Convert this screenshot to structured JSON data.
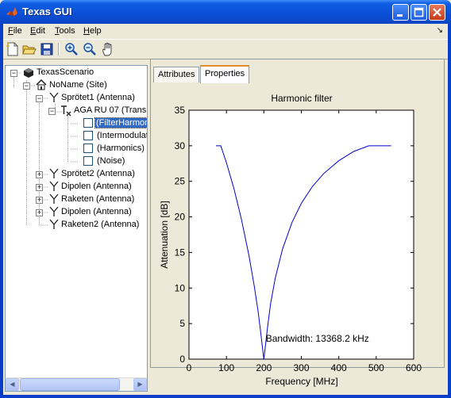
{
  "window": {
    "title": "Texas GUI"
  },
  "menu": [
    {
      "label": "File",
      "u": "F",
      "rest": "ile"
    },
    {
      "label": "Edit",
      "u": "E",
      "rest": "dit"
    },
    {
      "label": "Tools",
      "u": "T",
      "rest": "ools"
    },
    {
      "label": "Help",
      "u": "H",
      "rest": "elp"
    }
  ],
  "toolbar": [
    "new-file-icon",
    "open-folder-icon",
    "save-disk-icon",
    "zoom-in-icon",
    "zoom-out-icon",
    "pan-hand-icon"
  ],
  "tree": {
    "items": [
      {
        "label": "TexasScenario"
      },
      {
        "label": "NoName (Site)"
      },
      {
        "label": "Sprötet1 (Antenna)"
      },
      {
        "label": "AGA RU 07 (Trans"
      },
      {
        "label": "(FilterHarmon"
      },
      {
        "label": "(Intermodulat"
      },
      {
        "label": "(Harmonics)"
      },
      {
        "label": "(Noise)"
      },
      {
        "label": "Sprötet2 (Antenna)"
      },
      {
        "label": "Dipolen (Antenna)"
      },
      {
        "label": "Raketen (Antenna)"
      },
      {
        "label": "Dipolen (Antenna)"
      },
      {
        "label": "Raketen2 (Antenna)"
      }
    ]
  },
  "tabs": [
    {
      "label": "Attributes"
    },
    {
      "label": "Properties"
    }
  ],
  "chart_data": {
    "type": "line",
    "title": "Harmonic filter",
    "xlabel": "Frequency [MHz]",
    "ylabel": "Attenuation [dB]",
    "xlim": [
      0,
      600
    ],
    "ylim": [
      0,
      35
    ],
    "xticks": [
      0,
      100,
      200,
      300,
      400,
      500,
      600
    ],
    "yticks": [
      0,
      5,
      10,
      15,
      20,
      25,
      30,
      35
    ],
    "annotation": "Bandwidth: 13368.2 kHz",
    "line_color": "#0000cc",
    "series": [
      {
        "x": [
          72,
          85,
          100,
          120,
          140,
          160,
          175,
          185,
          192,
          197,
          200,
          203,
          206,
          210,
          218,
          230,
          250,
          275,
          300,
          330,
          360,
          400,
          440,
          480,
          510,
          540
        ],
        "y": [
          30,
          30,
          27.6,
          24,
          19.7,
          14.6,
          10.1,
          6.5,
          3.5,
          1.3,
          0,
          1.3,
          2.8,
          4.6,
          7.8,
          11.3,
          15.5,
          19.2,
          21.9,
          24.3,
          26.1,
          27.9,
          29.2,
          30,
          30,
          30
        ]
      }
    ]
  }
}
